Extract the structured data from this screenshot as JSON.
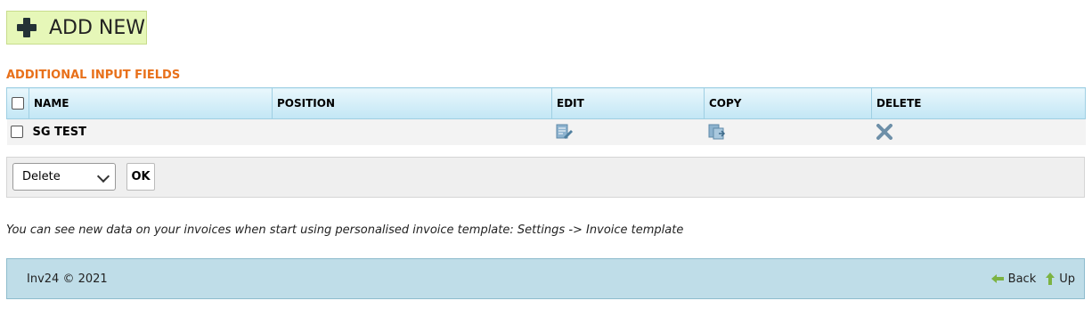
{
  "add_new": {
    "label": "ADD NEW",
    "icon": "plus-icon"
  },
  "section": {
    "title": "ADDITIONAL INPUT FIELDS"
  },
  "table": {
    "headers": {
      "name": "NAME",
      "position": "POSITION",
      "edit": "EDIT",
      "copy": "COPY",
      "delete": "DELETE"
    },
    "rows": [
      {
        "name": "SG TEST",
        "position": "",
        "edit_icon": "edit-icon",
        "copy_icon": "copy-icon",
        "delete_icon": "delete-icon"
      }
    ]
  },
  "bulk": {
    "selected_action": "Delete",
    "ok_label": "OK"
  },
  "note": "You can see new data on your invoices when start using personalised invoice template: Settings -> Invoice template",
  "footer": {
    "copyright": "Inv24 © 2021",
    "back_label": "Back",
    "up_label": "Up"
  },
  "colors": {
    "section_title": "#e8701a",
    "add_new_bg": "#e6f7b8",
    "footer_bg": "#bfdde8",
    "header_bg": "#c2e6f5"
  }
}
